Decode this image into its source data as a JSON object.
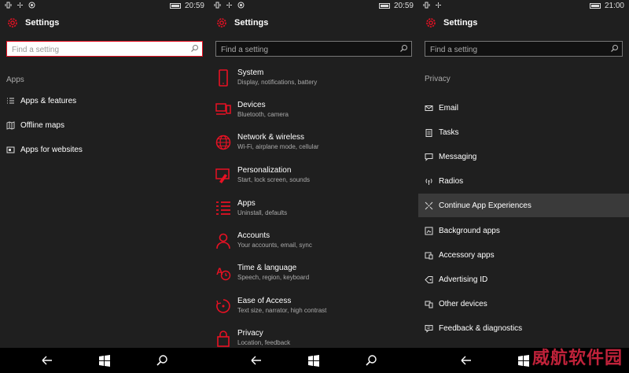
{
  "accent": "#e81123",
  "panels": [
    {
      "time": "20:59",
      "title": "Settings",
      "search_placeholder": "Find a setting",
      "section": "Apps",
      "items": [
        {
          "label": "Apps & features",
          "icon": "list-icon"
        },
        {
          "label": "Offline maps",
          "icon": "map-icon"
        },
        {
          "label": "Apps for websites",
          "icon": "website-icon"
        }
      ]
    },
    {
      "time": "20:59",
      "title": "Settings",
      "search_placeholder": "Find a setting",
      "items": [
        {
          "label": "System",
          "desc": "Display, notifications, battery",
          "icon": "phone-icon"
        },
        {
          "label": "Devices",
          "desc": "Bluetooth, camera",
          "icon": "devices-icon"
        },
        {
          "label": "Network & wireless",
          "desc": "Wi-Fi, airplane mode, cellular",
          "icon": "globe-icon"
        },
        {
          "label": "Personalization",
          "desc": "Start, lock screen, sounds",
          "icon": "paint-icon"
        },
        {
          "label": "Apps",
          "desc": "Uninstall, defaults",
          "icon": "list-icon"
        },
        {
          "label": "Accounts",
          "desc": "Your accounts, email, sync",
          "icon": "person-icon"
        },
        {
          "label": "Time & language",
          "desc": "Speech, region, keyboard",
          "icon": "time-language-icon"
        },
        {
          "label": "Ease of Access",
          "desc": "Text size, narrator, high contrast",
          "icon": "ease-of-access-icon"
        },
        {
          "label": "Privacy",
          "desc": "Location, feedback",
          "icon": "lock-icon"
        }
      ]
    },
    {
      "time": "21:00",
      "title": "Settings",
      "search_placeholder": "Find a setting",
      "section": "Privacy",
      "items": [
        {
          "label": "Email",
          "icon": "mail-icon"
        },
        {
          "label": "Tasks",
          "icon": "tasks-icon"
        },
        {
          "label": "Messaging",
          "icon": "message-icon"
        },
        {
          "label": "Radios",
          "icon": "radio-icon"
        },
        {
          "label": "Continue App Experiences",
          "icon": "continue-icon"
        },
        {
          "label": "Background apps",
          "icon": "background-apps-icon"
        },
        {
          "label": "Accessory apps",
          "icon": "accessory-icon"
        },
        {
          "label": "Advertising ID",
          "icon": "tag-icon"
        },
        {
          "label": "Other devices",
          "icon": "other-devices-icon"
        },
        {
          "label": "Feedback & diagnostics",
          "icon": "feedback-icon"
        }
      ]
    }
  ],
  "watermark": "威航软件园"
}
